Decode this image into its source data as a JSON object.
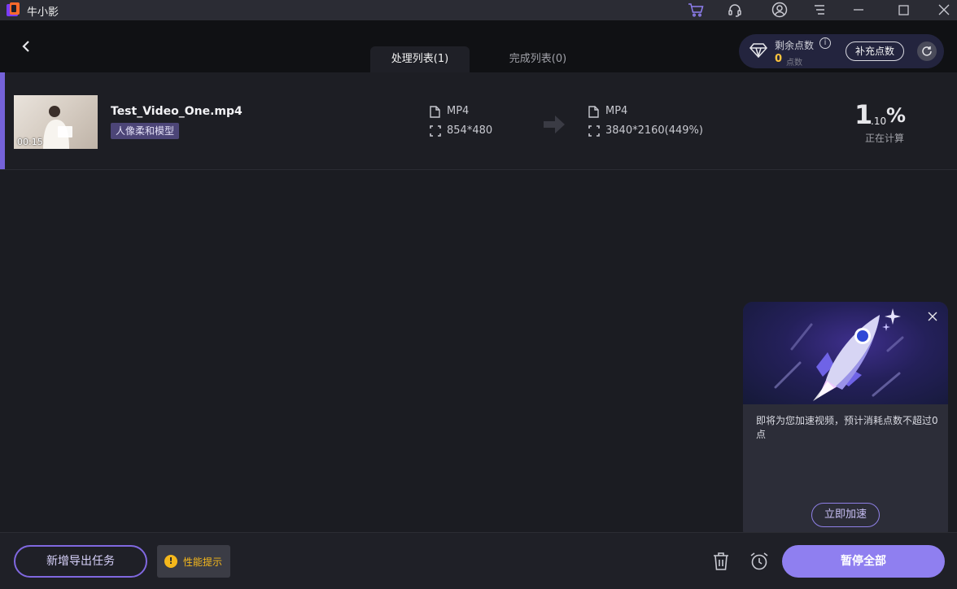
{
  "app": {
    "name": "牛小影"
  },
  "tabs": [
    {
      "label": "处理列表(1)",
      "active": true
    },
    {
      "label": "完成列表(0)",
      "active": false
    }
  ],
  "points": {
    "label": "剩余点数",
    "value": "0",
    "unit": "点数",
    "recharge_label": "补充点数"
  },
  "task": {
    "file_name": "Test_Video_One.mp4",
    "duration": "00:15",
    "model_tag": "人像柔和模型",
    "source": {
      "format": "MP4",
      "resolution": "854*480"
    },
    "target": {
      "format": "MP4",
      "resolution": "3840*2160(449%)"
    },
    "progress_int": "1",
    "progress_dec": ".10",
    "progress_unit": "%",
    "status": "正在计算"
  },
  "popup": {
    "message": "即将为您加速视频，预计消耗点数不超过0点",
    "button_label": "立即加速"
  },
  "footer": {
    "new_task_label": "新增导出任务",
    "perf_tip_label": "性能提示",
    "perf_tip_icon": "!",
    "pause_all_label": "暂停全部"
  },
  "colors": {
    "accent": "#8f7ff0",
    "accent_border": "#8068e0",
    "warning": "#f5b81c",
    "points_value": "#ffc53d",
    "background": "#1b1c22"
  }
}
